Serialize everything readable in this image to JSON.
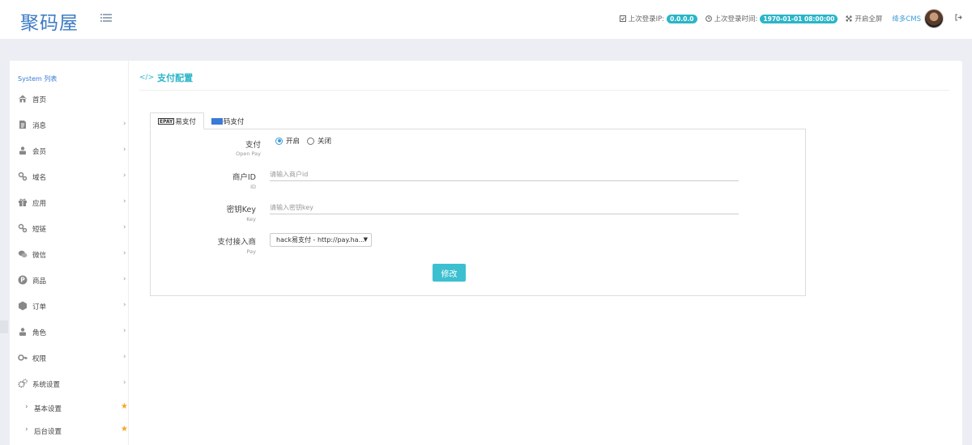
{
  "header": {
    "logo": "聚码屋",
    "last_ip_label": "上次登录IP:",
    "last_ip_value": "0.0.0.0",
    "last_time_label": "上次登录时间:",
    "last_time_value": "1970-01-01 08:00:00",
    "fullscreen_label": "开启全屏",
    "user_label": "绛多CMS"
  },
  "sidebar": {
    "title": "System 列表",
    "items": [
      {
        "label": "首页",
        "icon": "home-icon"
      },
      {
        "label": "消息",
        "icon": "document-icon"
      },
      {
        "label": "会员",
        "icon": "user-icon"
      },
      {
        "label": "域名",
        "icon": "link-icon"
      },
      {
        "label": "应用",
        "icon": "gift-icon"
      },
      {
        "label": "短链",
        "icon": "link-icon"
      },
      {
        "label": "微信",
        "icon": "wechat-icon"
      },
      {
        "label": "商品",
        "icon": "product-icon"
      },
      {
        "label": "订单",
        "icon": "order-icon"
      },
      {
        "label": "角色",
        "icon": "role-icon"
      },
      {
        "label": "权限",
        "icon": "key-icon"
      },
      {
        "label": "系统设置",
        "icon": "gear-icon"
      }
    ],
    "sub_items": [
      {
        "label": "基本设置"
      },
      {
        "label": "后台设置"
      }
    ]
  },
  "page": {
    "title": "支付配置",
    "tabs": [
      {
        "label": "易支付",
        "badge": "EPAY"
      },
      {
        "label": "码支付"
      }
    ],
    "form": {
      "open_pay_label": "支付",
      "open_pay_sub": "Open Pay",
      "radio_on": "开启",
      "radio_off": "关闭",
      "radio_selected": "开启",
      "merchant_label": "商户ID",
      "merchant_sub": "ID",
      "merchant_placeholder": "请输入商户id",
      "merchant_value": "",
      "key_label": "密钥Key",
      "key_sub": "Key",
      "key_placeholder": "请输入密钥key",
      "key_value": "",
      "provider_label": "支付接入商",
      "provider_sub": "Pay",
      "provider_selected": "hack易支付 - http://pay.ha...",
      "submit_label": "修改"
    }
  },
  "colors": {
    "accent": "#2bb5c8",
    "link": "#3a9bd9",
    "logo": "#3d7bc4",
    "star": "#f5a623"
  }
}
